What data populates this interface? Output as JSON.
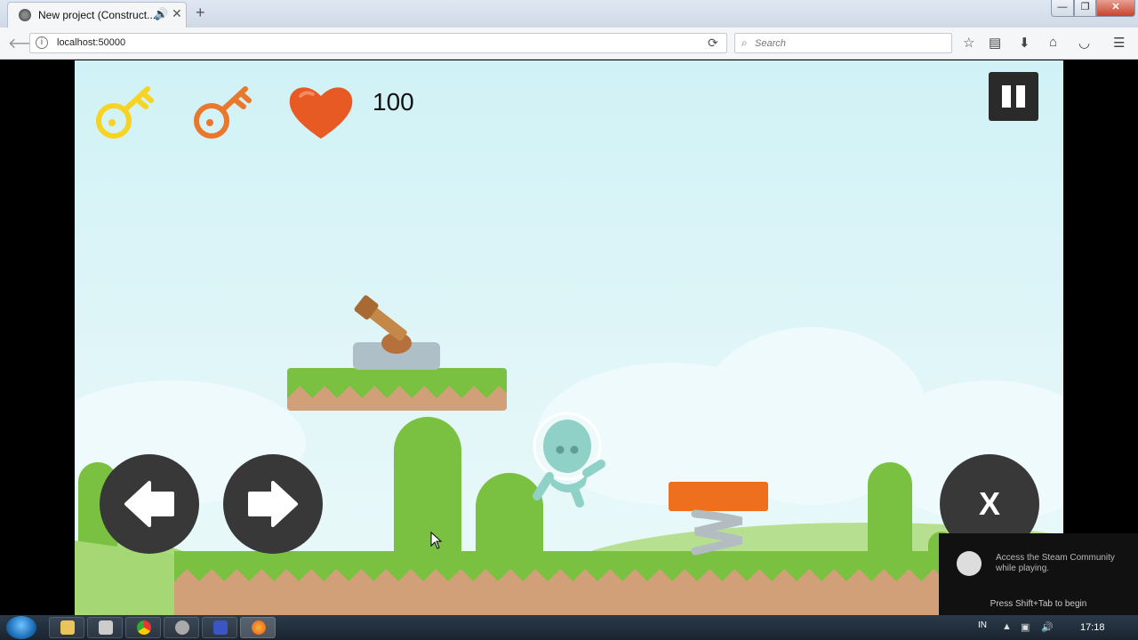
{
  "browser": {
    "tab_title": "New project (Construct...",
    "new_tab": "+",
    "url": "localhost:50000",
    "search_placeholder": "Search",
    "win_min": "—",
    "win_max": "❐",
    "win_close": "✕"
  },
  "hud": {
    "key_gold_icon": "key-icon",
    "key_orange_icon": "key-icon",
    "heart_icon": "heart-icon",
    "health": "100",
    "x_button_label": "X"
  },
  "steam_overlay": {
    "message": "Access the Steam Community while playing.",
    "hint": "Press Shift+Tab to begin"
  },
  "taskbar": {
    "language": "IN",
    "time": "17:18"
  },
  "colors": {
    "key_gold": "#f7d323",
    "key_orange": "#e9772c",
    "heart": "#e85a24",
    "grass": "#7ac142",
    "dirt": "#d2a078",
    "sky": "#d4f3f7",
    "spring_top": "#ee6f1e"
  }
}
